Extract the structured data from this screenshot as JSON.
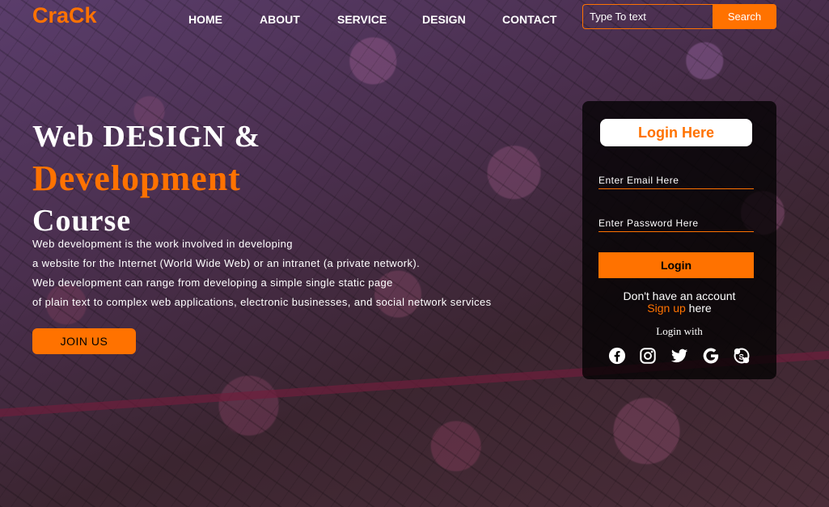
{
  "header": {
    "logo": "CraCk",
    "nav": [
      "HOME",
      "ABOUT",
      "SERVICE",
      "DESIGN",
      "CONTACT"
    ],
    "search": {
      "placeholder": "Type To text",
      "button": "Search"
    }
  },
  "hero": {
    "title_line1": "Web DESIGN &",
    "title_line2": "Development",
    "title_line3": "Course",
    "description": [
      "Web development is the work involved in developing",
      "a website for the Internet (World Wide Web) or an intranet (a private network).",
      "Web development can range from developing a simple single static page",
      "of plain text to complex web applications, electronic businesses, and social network services"
    ],
    "join_button": "JOIN US"
  },
  "login": {
    "title": "Login Here",
    "email_placeholder": "Enter Email Here",
    "password_placeholder": "Enter Password Here",
    "button": "Login",
    "no_account": "Don't have an account",
    "signup_link": "Sign up",
    "signup_suffix": " here",
    "login_with": "Login with",
    "socials": [
      "facebook-icon",
      "instagram-icon",
      "twitter-icon",
      "google-icon",
      "skype-icon"
    ]
  },
  "colors": {
    "accent": "#ff7200",
    "card": "#000000"
  }
}
